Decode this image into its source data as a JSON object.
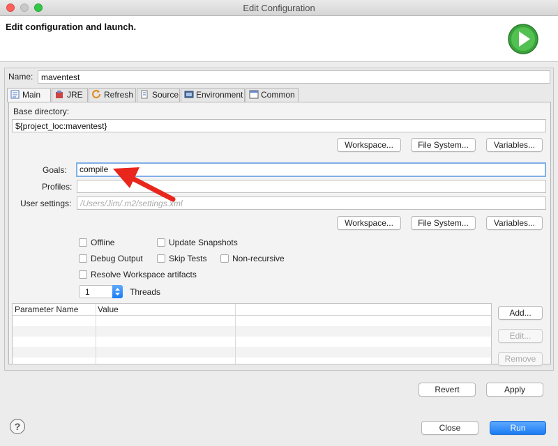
{
  "window": {
    "title": "Edit Configuration"
  },
  "header": {
    "text": "Edit configuration and launch."
  },
  "name_field": {
    "label": "Name:",
    "value": "maventest"
  },
  "tabs": [
    {
      "label": "Main",
      "icon": "main-icon",
      "active": true
    },
    {
      "label": "JRE",
      "icon": "jre-icon",
      "active": false
    },
    {
      "label": "Refresh",
      "icon": "refresh-icon",
      "active": false
    },
    {
      "label": "Source",
      "icon": "source-icon",
      "active": false
    },
    {
      "label": "Environment",
      "icon": "environment-icon",
      "active": false
    },
    {
      "label": "Common",
      "icon": "common-icon",
      "active": false
    }
  ],
  "main": {
    "base_dir_label": "Base directory:",
    "base_dir_value": "${project_loc:maventest}",
    "workspace_btn": "Workspace...",
    "filesystem_btn": "File System...",
    "variables_btn": "Variables...",
    "goals_label": "Goals:",
    "goals_value": "compile",
    "profiles_label": "Profiles:",
    "profiles_value": "",
    "user_settings_label": "User settings:",
    "user_settings_placeholder": "/Users/Jim/.m2/settings.xml",
    "checkboxes": {
      "offline": "Offline",
      "update_snapshots": "Update Snapshots",
      "debug_output": "Debug Output",
      "skip_tests": "Skip Tests",
      "non_recursive": "Non-recursive",
      "resolve_workspace": "Resolve Workspace artifacts"
    },
    "threads_value": "1",
    "threads_label": "Threads",
    "table": {
      "columns": [
        "Parameter Name",
        "Value"
      ]
    },
    "add_btn": "Add...",
    "edit_btn": "Edit...",
    "remove_btn": "Remove"
  },
  "footer": {
    "revert_btn": "Revert",
    "apply_btn": "Apply",
    "close_btn": "Close",
    "run_btn": "Run",
    "help_glyph": "?"
  },
  "colors": {
    "accent": "#1a7cf2",
    "annotation_arrow": "#e8261c",
    "run_icon": "#3aa33a"
  }
}
